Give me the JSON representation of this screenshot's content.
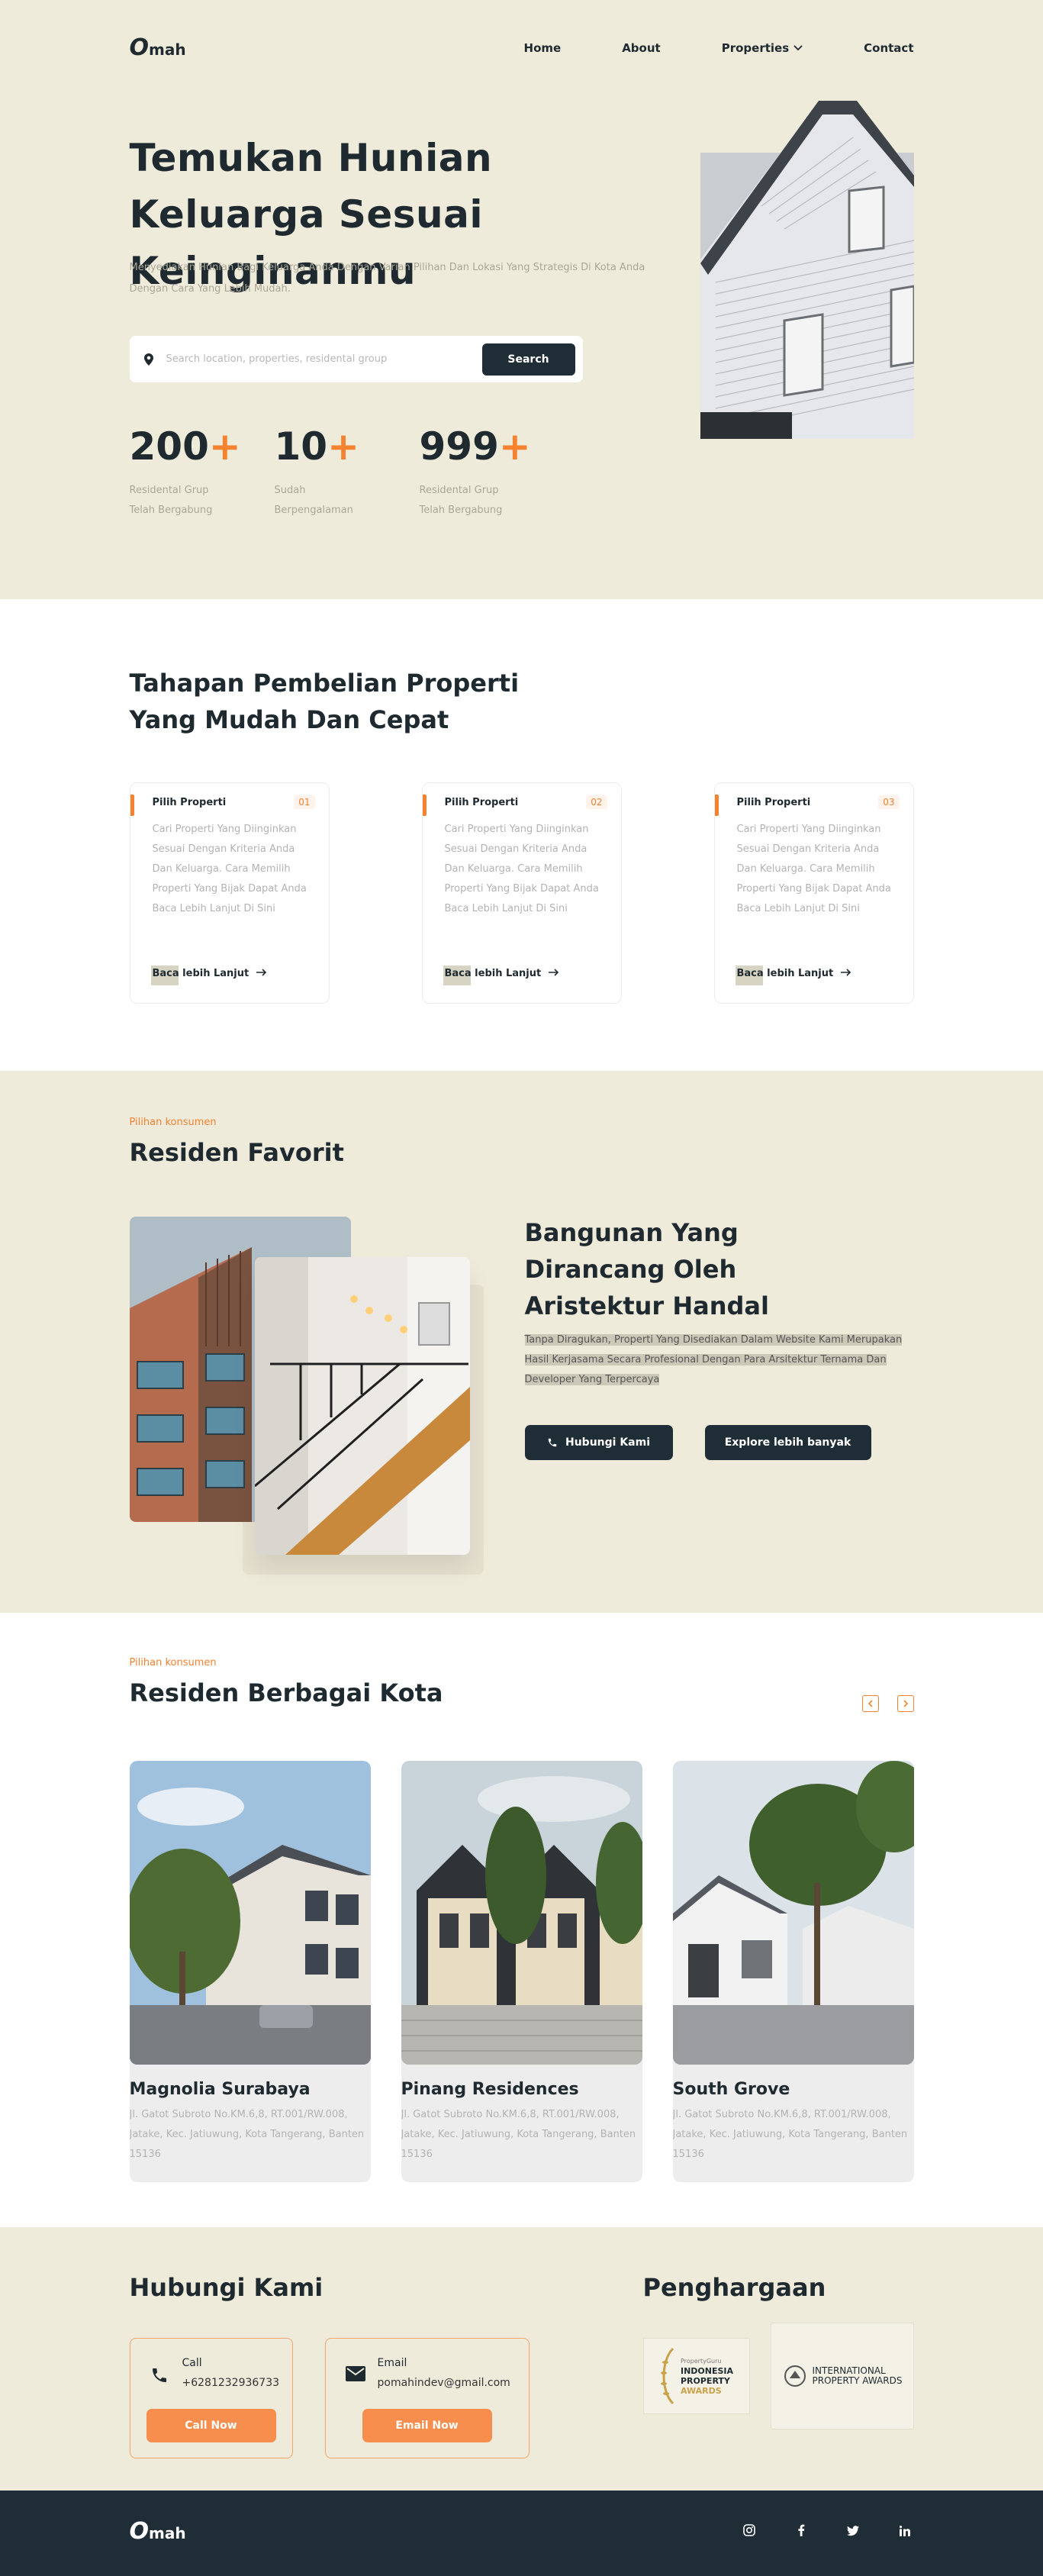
{
  "nav": {
    "logo_o": "O",
    "logo_text": "mah",
    "links": [
      "Home",
      "About",
      "Properties",
      "Contact"
    ]
  },
  "hero": {
    "title": "Temukan Hunian Keluarga Sesuai Keinginanmu",
    "subtitle": "Menyediakan Hunian Bagi Keluarga Anda Dengan Varian Pilihan Dan Lokasi Yang Strategis Di Kota Anda Dengan Cara Yang Lebih Mudah.",
    "search_placeholder": "Search location, properties, residental group",
    "search_button": "Search",
    "stats": [
      {
        "num": "200",
        "plus": "+",
        "label": "Residental Grup Telah Bergabung"
      },
      {
        "num": "10",
        "plus": "+",
        "label": "Sudah Berpengalaman"
      },
      {
        "num": "999",
        "plus": "+",
        "label": "Residental Grup Telah Bergabung"
      }
    ]
  },
  "steps": {
    "title": "Tahapan Pembelian Properti Yang Mudah Dan Cepat",
    "cards": [
      {
        "title": "Pilih Properti",
        "no": "01",
        "desc": "Cari Properti Yang Diinginkan Sesuai Dengan Kriteria Anda Dan Keluarga. Cara Memilih Properti Yang Bijak Dapat Anda Baca Lebih Lanjut Di Sini",
        "more": "Baca lebih Lanjut"
      },
      {
        "title": "Pilih Properti",
        "no": "02",
        "desc": "Cari Properti Yang Diinginkan Sesuai Dengan Kriteria Anda Dan Keluarga. Cara Memilih Properti Yang Bijak Dapat Anda Baca Lebih Lanjut Di Sini",
        "more": "Baca lebih Lanjut"
      },
      {
        "title": "Pilih Properti",
        "no": "03",
        "desc": "Cari Properti Yang Diinginkan Sesuai Dengan Kriteria Anda Dan Keluarga. Cara Memilih Properti Yang Bijak Dapat Anda Baca Lebih Lanjut Di Sini",
        "more": "Baca lebih Lanjut"
      }
    ]
  },
  "favorit": {
    "kicker": "Pilihan konsumen",
    "title": "Residen Favorit",
    "heading": "Bangunan Yang Dirancang Oleh Aristektur Handal",
    "paragraph": "Tanpa Diragukan, Properti Yang Disediakan Dalam Website Kami Merupakan Hasil Kerjasama Secara Profesional Dengan Para Arsitektur Ternama Dan Developer Yang Terpercaya",
    "btn_contact": "Hubungi Kami",
    "btn_explore": "Explore lebih banyak"
  },
  "kota": {
    "kicker": "Pilihan konsumen",
    "title": "Residen Berbagai Kota",
    "listings": [
      {
        "name": "Magnolia Surabaya",
        "address": "Jl. Gatot Subroto No.KM.6,8, RT.001/RW.008, Jatake, Kec. Jatiuwung, Kota Tangerang, Banten 15136"
      },
      {
        "name": "Pinang Residences",
        "address": "Jl. Gatot Subroto No.KM.6,8, RT.001/RW.008, Jatake, Kec. Jatiuwung, Kota Tangerang, Banten 15136"
      },
      {
        "name": "South Grove",
        "address": "Jl. Gatot Subroto No.KM.6,8, RT.001/RW.008, Jatake, Kec. Jatiuwung, Kota Tangerang, Banten 15136"
      }
    ]
  },
  "contact": {
    "title": "Hubungi Kami",
    "call": {
      "label": "Call",
      "value": "+6281232936733",
      "button": "Call Now"
    },
    "email": {
      "label": "Email",
      "value": "pomahindev@gmail.com",
      "button": "Email Now"
    },
    "awards_title": "Penghargaan",
    "awards": [
      {
        "line1": "PropertyGuru",
        "line2": "INDONESIA",
        "line3": "PROPERTY",
        "line4": "AWARDS"
      },
      {
        "line1": "INTERNATIONAL",
        "line2": "PROPERTY AWARDS"
      }
    ]
  },
  "footer": {
    "logo_o": "O",
    "logo_text": "mah",
    "socials": [
      "instagram-icon",
      "facebook-icon",
      "twitter-icon",
      "linkedin-icon"
    ]
  },
  "colors": {
    "accent": "#f5822f",
    "dark": "#1f2d36",
    "cream": "#efebdb"
  }
}
